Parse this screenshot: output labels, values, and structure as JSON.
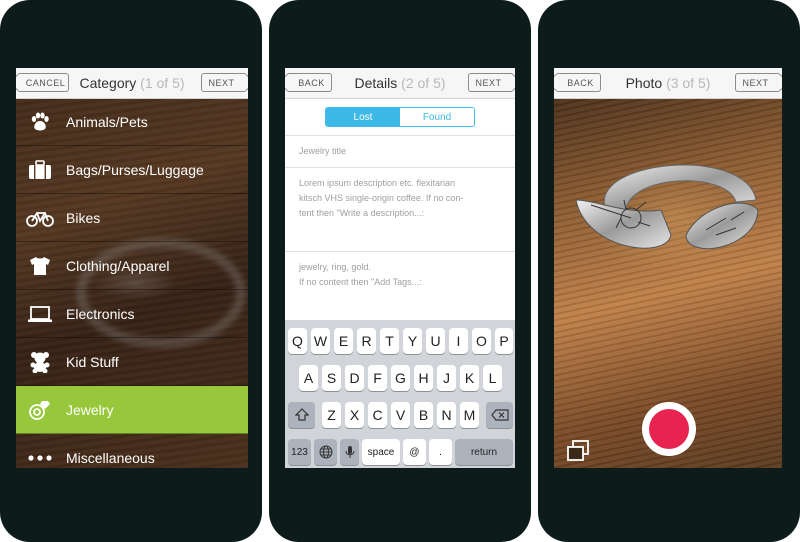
{
  "category_screen": {
    "left_button": "CANCEL",
    "title": "Category",
    "step": "(1 of 5)",
    "right_button": "NEXT",
    "items": [
      {
        "label": "Animals/Pets",
        "icon": "paw-icon"
      },
      {
        "label": "Bags/Purses/Luggage",
        "icon": "suitcase-icon"
      },
      {
        "label": "Bikes",
        "icon": "bike-icon"
      },
      {
        "label": "Clothing/Apparel",
        "icon": "tshirt-icon"
      },
      {
        "label": "Electronics",
        "icon": "laptop-icon"
      },
      {
        "label": "Kid Stuff",
        "icon": "teddy-bear-icon"
      },
      {
        "label": "Jewelry",
        "icon": "jewelry-icon",
        "selected": true
      },
      {
        "label": "Miscellaneous",
        "icon": "more-dots-icon"
      }
    ],
    "selected_color": "#97c83c"
  },
  "details_screen": {
    "left_button": "BACK",
    "title": "Details",
    "step": "(2 of 5)",
    "right_button": "NEXT",
    "segment": {
      "lost": "Lost",
      "found": "Found",
      "selected": "Lost"
    },
    "title_placeholder": "Jewelry title",
    "description_line1": "Lorem ipsum description etc. flexitarian",
    "description_line2": "kitsch VHS single-origin coffee. If no con-",
    "description_line3": "tent then \"Write a description...:",
    "tags_line1": "jewelry, ring, gold.",
    "tags_line2": "If no content then \"Add Tags...:",
    "keyboard": {
      "row1": [
        "Q",
        "W",
        "E",
        "R",
        "T",
        "Y",
        "U",
        "I",
        "O",
        "P"
      ],
      "row2": [
        "A",
        "S",
        "D",
        "F",
        "G",
        "H",
        "J",
        "K",
        "L"
      ],
      "row3": [
        "Z",
        "X",
        "C",
        "V",
        "B",
        "N",
        "M"
      ],
      "numbers": "123",
      "space": "space",
      "at": "@",
      "dot": ".",
      "return": "return"
    },
    "accent_color": "#3cb9e6"
  },
  "photo_screen": {
    "left_button": "BACK",
    "title": "Photo",
    "step": "(3 of 5)",
    "right_button": "NEXT",
    "shutter_color": "#e8234f"
  }
}
